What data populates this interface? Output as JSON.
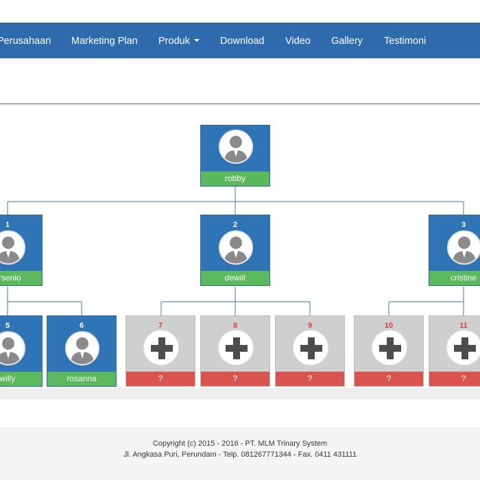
{
  "navbar": {
    "items": [
      {
        "label": "Perusahaan"
      },
      {
        "label": "Marketing Plan"
      },
      {
        "label": "Produk",
        "dropdown": true
      },
      {
        "label": "Download"
      },
      {
        "label": "Video"
      },
      {
        "label": "Gallery"
      },
      {
        "label": "Testimoni"
      }
    ]
  },
  "tree": {
    "root": {
      "name": "robby"
    },
    "level1": [
      {
        "number": "1",
        "name": "arsenio"
      },
      {
        "number": "2",
        "name": "dewiit"
      },
      {
        "number": "3",
        "name": "cristine"
      }
    ],
    "level2": [
      {
        "number": "5",
        "name": "willy",
        "status": "member"
      },
      {
        "number": "6",
        "name": "rosanna",
        "status": "member"
      },
      {
        "number": "7",
        "name": "?",
        "status": "empty"
      },
      {
        "number": "8",
        "name": "?",
        "status": "empty"
      },
      {
        "number": "9",
        "name": "?",
        "status": "empty"
      },
      {
        "number": "10",
        "name": "?",
        "status": "empty"
      },
      {
        "number": "11",
        "name": "?",
        "status": "empty"
      }
    ]
  },
  "footer": {
    "copyright": "Copyright (c) 2015 - 2016 - PT. MLM Trinary System",
    "address": "Jl. Angkasa Puri, Perundam - Telp. 081267771344 - Fax. 0411 431111"
  },
  "colors": {
    "navbar": "#2e6aac",
    "member_box": "#2f74b5",
    "name_bar": "#5cb85c",
    "empty_box": "#cfcfcf",
    "empty_bar": "#d9534f",
    "empty_number": "#d9403a",
    "connector": "#5b8fbf"
  }
}
